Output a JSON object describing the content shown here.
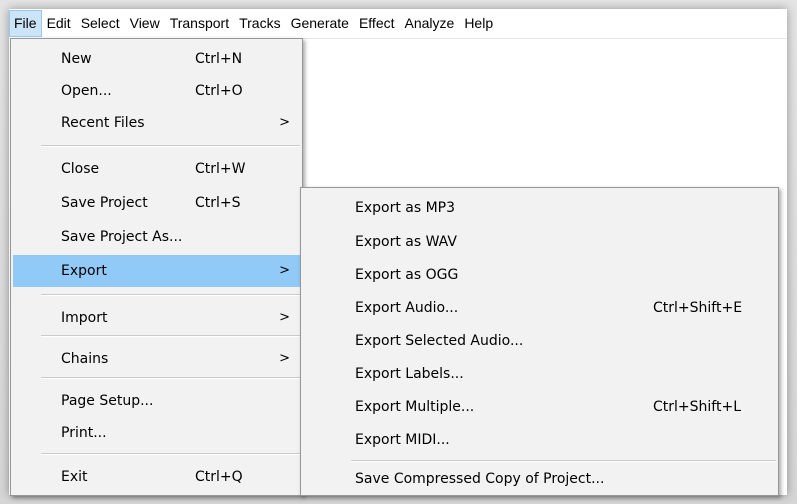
{
  "menubar": {
    "items": [
      "File",
      "Edit",
      "Select",
      "View",
      "Transport",
      "Tracks",
      "Generate",
      "Effect",
      "Analyze",
      "Help"
    ],
    "active": "File"
  },
  "file_menu": {
    "items": [
      {
        "label": "New",
        "shortcut": "Ctrl+N"
      },
      {
        "label": "Open...",
        "shortcut": "Ctrl+O"
      },
      {
        "label": "Recent Files",
        "submenu": true
      },
      {
        "label": "Close",
        "shortcut": "Ctrl+W"
      },
      {
        "label": "Save Project",
        "shortcut": "Ctrl+S"
      },
      {
        "label": "Save Project As..."
      },
      {
        "label": "Export",
        "submenu": true,
        "highlighted": true
      },
      {
        "label": "Import",
        "submenu": true
      },
      {
        "label": "Chains",
        "submenu": true
      },
      {
        "label": "Page Setup..."
      },
      {
        "label": "Print..."
      },
      {
        "label": "Exit",
        "shortcut": "Ctrl+Q"
      }
    ],
    "arrow": ">"
  },
  "export_menu": {
    "items": [
      {
        "label": "Export as MP3"
      },
      {
        "label": "Export as WAV"
      },
      {
        "label": "Export as OGG"
      },
      {
        "label": "Export Audio...",
        "shortcut": "Ctrl+Shift+E"
      },
      {
        "label": "Export Selected Audio..."
      },
      {
        "label": "Export Labels..."
      },
      {
        "label": "Export Multiple...",
        "shortcut": "Ctrl+Shift+L"
      },
      {
        "label": "Export MIDI..."
      },
      {
        "label": "Save Compressed Copy of Project..."
      }
    ]
  },
  "colors": {
    "highlight": "#91c9f7",
    "menubar_active": "#cce4f7",
    "menu_bg": "#f2f2f2"
  }
}
